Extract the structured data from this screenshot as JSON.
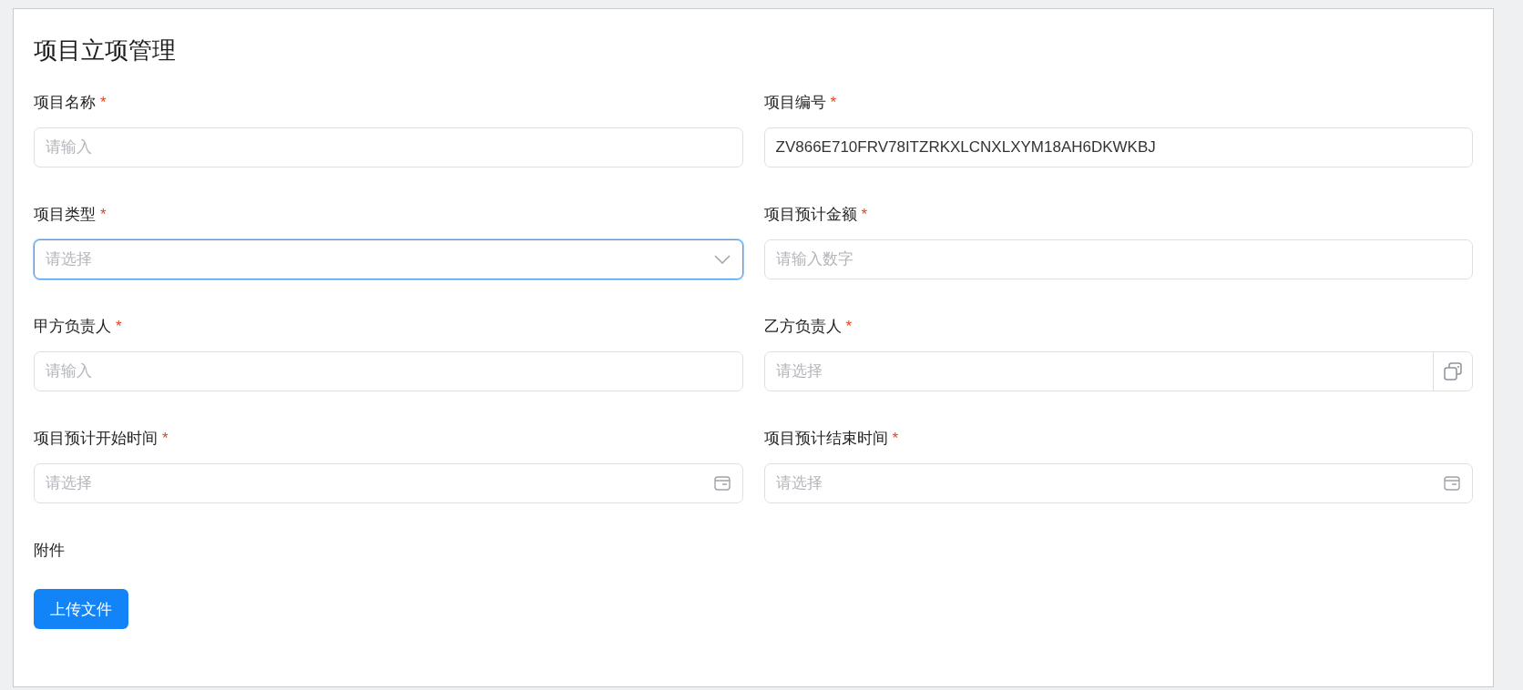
{
  "title": "项目立项管理",
  "required_mark": "*",
  "fields": [
    {
      "label": "项目名称",
      "required": true,
      "kind": "text",
      "placeholder": "请输入",
      "focused": false
    },
    {
      "label": "项目编号",
      "required": true,
      "kind": "text",
      "value": "ZV866E710FRV78ITZRKXLCNXLXYM18AH6DKWKBJ",
      "focused": false
    },
    {
      "label": "项目类型",
      "required": true,
      "kind": "select",
      "placeholder": "请选择",
      "focused": true
    },
    {
      "label": "项目预计金额",
      "required": true,
      "kind": "text",
      "placeholder": "请输入数字",
      "focused": false
    },
    {
      "label": "甲方负责人",
      "required": true,
      "kind": "text",
      "placeholder": "请输入",
      "focused": false
    },
    {
      "label": "乙方负责人",
      "required": true,
      "kind": "picker",
      "placeholder": "请选择",
      "focused": false
    },
    {
      "label": "项目预计开始时间",
      "required": true,
      "kind": "date",
      "placeholder": "请选择",
      "focused": false
    },
    {
      "label": "项目预计结束时间",
      "required": true,
      "kind": "date",
      "placeholder": "请选择",
      "focused": false
    }
  ],
  "attachment": {
    "label": "附件",
    "button": "上传文件"
  }
}
